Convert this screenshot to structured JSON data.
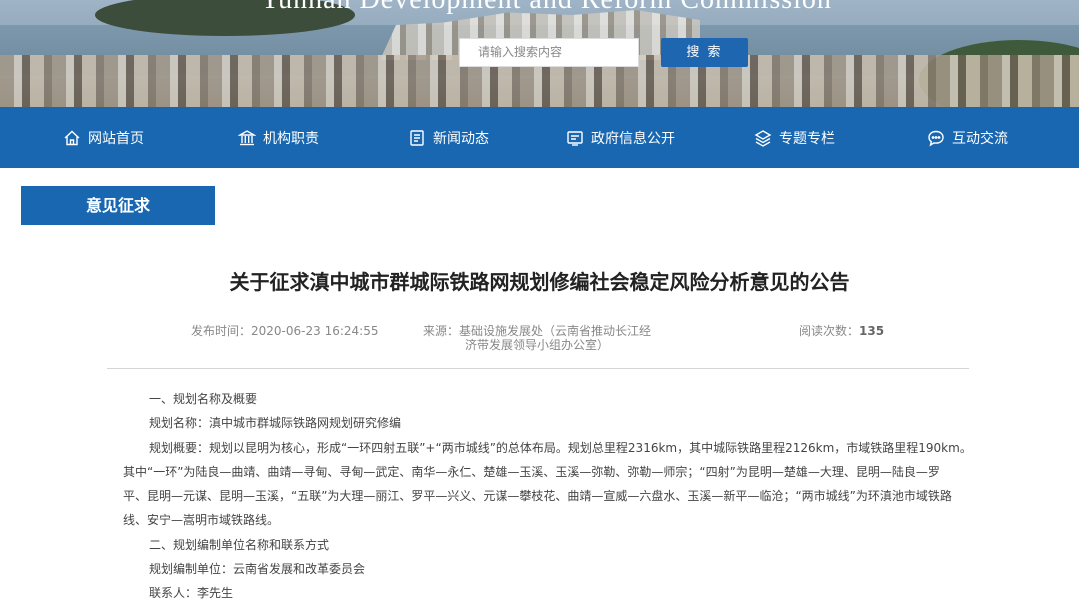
{
  "banner": {
    "tagline": "Yunnan Development and Reform Commission",
    "search_placeholder": "请输入搜索内容",
    "search_button": "搜 索"
  },
  "nav": {
    "items": [
      {
        "label": "网站首页",
        "icon": "home-icon"
      },
      {
        "label": "机构职责",
        "icon": "institution-icon"
      },
      {
        "label": "新闻动态",
        "icon": "news-icon"
      },
      {
        "label": "政府信息公开",
        "icon": "gov-info-icon"
      },
      {
        "label": "专题专栏",
        "icon": "layers-icon"
      },
      {
        "label": "互动交流",
        "icon": "chat-icon"
      }
    ]
  },
  "section": {
    "tab_label": "意见征求"
  },
  "article": {
    "title": "关于征求滇中城市群城际铁路网规划修编社会稳定风险分析意见的公告",
    "publish_label": "发布时间：",
    "publish_time": "2020-06-23 16:24:55",
    "source_label": "来源：",
    "source_line1": "基础设施发展处（云南省推动长江经",
    "source_line2": "济带发展领导小组办公室）",
    "reads_label": "阅读次数：",
    "reads_count": "135",
    "paragraphs": {
      "p1": "一、规划名称及概要",
      "p2": "规划名称：滇中城市群城际铁路网规划研究修编",
      "p3a": "规划概要：规划以昆明为核心，形成“一环四射五联”+“两市城线”的总体布局。规划总里程2316km，其中城际铁路里程2126km，市域铁路里程190km。",
      "p3b": "其中“一环”为陆良—曲靖、曲靖—寻甸、寻甸—武定、南华—永仁、楚雄—玉溪、玉溪—弥勒、弥勒—师宗；“四射”为昆明—楚雄—大理、昆明—陆良—罗",
      "p3c": "平、昆明—元谋、昆明—玉溪，“五联”为大理—丽江、罗平—兴义、元谋—攀枝花、曲靖—宣威—六盘水、玉溪—新平—临沧；“两市城线”为环滇池市域铁路",
      "p3d": "线、安宁—嵩明市域铁路线。",
      "p4": "二、规划编制单位名称和联系方式",
      "p5": "规划编制单位：云南省发展和改革委员会",
      "p6": "联系人：李先生"
    }
  }
}
